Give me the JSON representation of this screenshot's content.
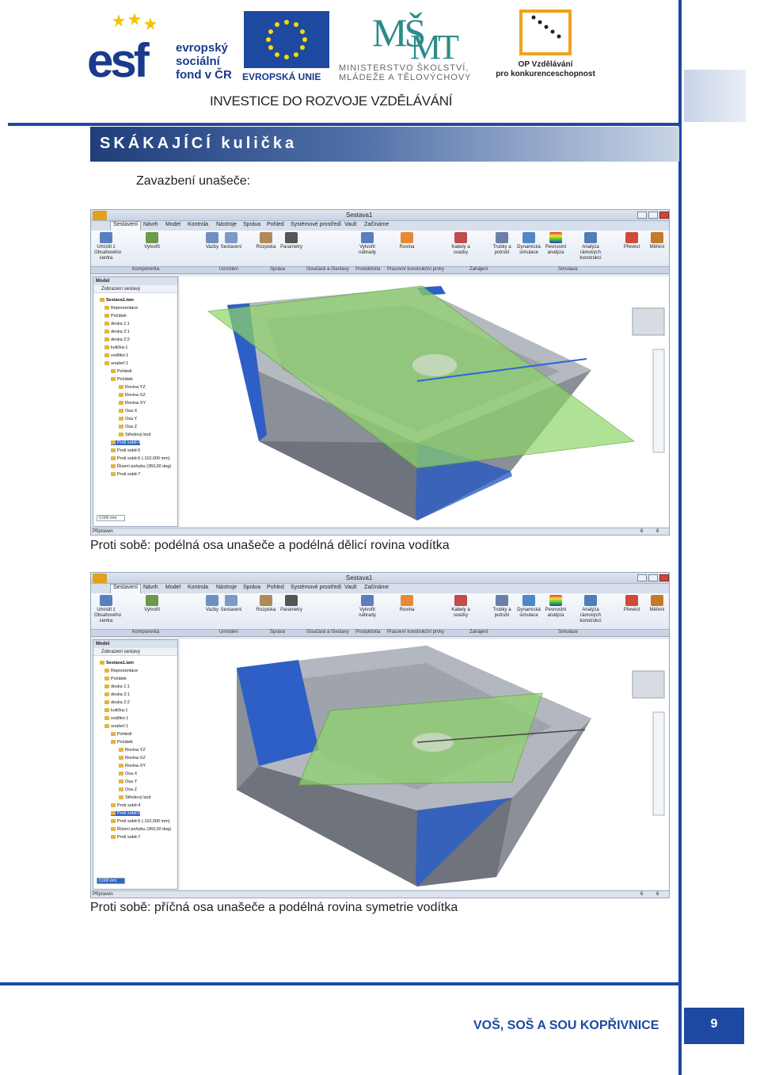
{
  "header": {
    "esf_word": "esf",
    "esf_sub_1": "evropský",
    "esf_sub_2": "sociální",
    "esf_sub_3": "fond v ČR",
    "eu_caption": "EVROPSKÁ UNIE",
    "msmt_caption_1": "MINISTERSTVO ŠKOLSTVÍ,",
    "msmt_caption_2": "MLÁDEŽE A TĚLOVÝCHOVY",
    "op_caption_1": "OP Vzdělávání",
    "op_caption_2": "pro konkurenceschopnost",
    "investice": "INVESTICE DO ROZVOJE VZDĚLÁVÁNÍ"
  },
  "title": "SKÁKAJÍCÍ kulička",
  "intro_label": "Zavazbení unašeče:",
  "screens": [
    {
      "window_title": "Sestava1",
      "status": "Připraven",
      "status_nums": [
        "6",
        "6"
      ],
      "browser_value": "0,000 mm",
      "caption": "Proti sobě: podélná osa unašeče a podélná dělicí rovina vodítka"
    },
    {
      "window_title": "Sestava1",
      "status": "Připraven",
      "status_nums": [
        "6",
        "6"
      ],
      "browser_value": "0,000 mm",
      "caption": "Proti sobě: příčná osa unašeče a podélná rovina symetrie vodítka"
    }
  ],
  "ribbon": {
    "tabs": [
      "Sestavení",
      "Návrh",
      "Model",
      "Kontrola",
      "Nástroje",
      "Správa",
      "Pohled",
      "Systémové prostředí",
      "Vault",
      "Začínáme"
    ],
    "buttons": [
      "Umístit z Obsahového centra",
      "Vytvořit",
      "Vazby",
      "Sestavení",
      "Rozpiska",
      "Parametry",
      "Vytvořit náhrady",
      "Rovina",
      "Kabely a svazky",
      "Trubky a potrubí",
      "Dynamická simulace",
      "Pevnostní analýza",
      "Analýza rámových konstrukcí",
      "Převést",
      "Měření"
    ],
    "panels": [
      "Komponenta",
      "Umístění",
      "Správa",
      "iSoučásti a iSestavy",
      "Produktivita",
      "Pracovní konstrukční prvky",
      "Zahájení",
      "Simulace"
    ]
  },
  "browser": {
    "header": "Model",
    "view": "Zobrazení sestavy",
    "items": [
      "Sestava1.iam",
      "Reprezentace",
      "Počátek",
      "deska 1:1",
      "deska 2:1",
      "deska 2:2",
      "kulička:1",
      "vodítko:1",
      "unašeč:1",
      "Pohledí",
      "Počátek",
      "Rovina YZ",
      "Rovina XZ",
      "Rovina XY",
      "Osa X",
      "Osa Y",
      "Osa Z",
      "Středový bod",
      "Proti sobě:4",
      "Proti sobě:5",
      "Proti sobě:6 (-110,000 mm)",
      "Řízení pohybu (360,00 deg)",
      "Proti sobě:7"
    ]
  },
  "footer": {
    "school": "VOŠ, SOŠ A SOU KOPŘIVNICE",
    "page": "9"
  },
  "colors": {
    "brand_blue": "#1d4aa0",
    "plane_green": "#8fd66a",
    "part_gray": "#8a8f98",
    "selection_blue": "#3364c7"
  }
}
